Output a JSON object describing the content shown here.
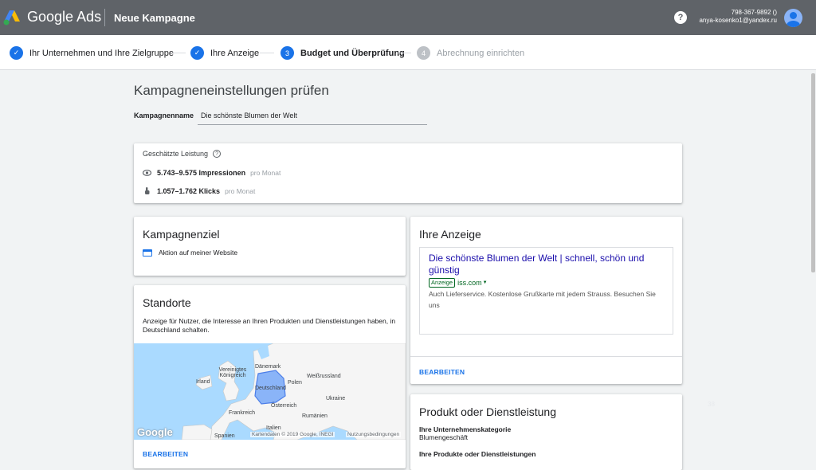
{
  "header": {
    "brand": "Google Ads",
    "campaign_title": "Neue Kampagne",
    "account_phone": "798-367-9892 ()",
    "account_email": "anya-kosenko1@yandex.ru",
    "help_icon": "help-icon",
    "colors": {
      "bar": "#5f6368",
      "accent": "#1a73e8"
    }
  },
  "steps": [
    {
      "label": "Ihr Unternehmen und Ihre Zielgruppe",
      "state": "done"
    },
    {
      "label": "Ihre Anzeige",
      "state": "done"
    },
    {
      "label": "Budget und Überprüfung",
      "state": "current",
      "number": "3"
    },
    {
      "label": "Abrechnung einrichten",
      "state": "todo",
      "number": "4"
    }
  ],
  "page": {
    "title": "Kampagneneinstellungen prüfen",
    "name_label": "Kampagnenname",
    "name_value": "Die schönste Blumen der Welt"
  },
  "performance": {
    "title": "Geschätzte Leistung",
    "impressions": "5.743–9.575 Impressionen",
    "impressions_unit": "pro Monat",
    "clicks": "1.057–1.762 Klicks",
    "clicks_unit": "pro Monat"
  },
  "goal": {
    "title": "Kampagnenziel",
    "value": "Aktion auf meiner Website"
  },
  "locations": {
    "title": "Standorte",
    "description": "Anzeige für Nutzer, die Interesse an Ihren Produkten und Dienstleistungen haben, in Deutschland schalten.",
    "edit": "BEARBEITEN",
    "map": {
      "labels": [
        "Dänemark",
        "Vereinigtes Königreich",
        "Irland",
        "Deutschland",
        "Polen",
        "Weißrussland",
        "Ukraine",
        "Frankreich",
        "Österreich",
        "Rumänien",
        "Italien",
        "Spanien"
      ],
      "logo": "Google",
      "credit": "Kartendaten © 2019 Google, INEGI",
      "terms": "Nutzungsbedingungen"
    }
  },
  "ad": {
    "title": "Ihre Anzeige",
    "headline": "Die schönste Blumen der Welt | schnell, schön und günstig",
    "tag": "Anzeige",
    "url": "iss.com",
    "description": "Auch Lieferservice. Kostenlose Grußkarte mit jedem Strauss. Besuchen Sie uns",
    "edit": "BEARBEITEN"
  },
  "product": {
    "title": "Produkt oder Dienstleistung",
    "category_label": "Ihre Unternehmenskategorie",
    "category_value": "Blumengeschäft",
    "products_label": "Ihre Produkte oder Dienstleistungen"
  },
  "overlay_text": "38"
}
